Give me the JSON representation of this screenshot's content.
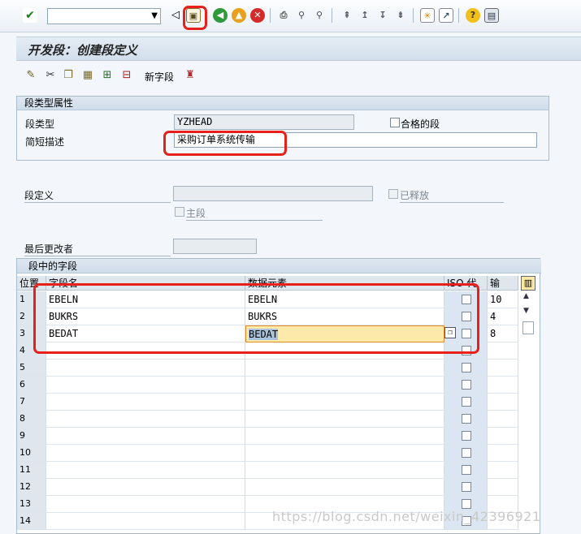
{
  "toolbar": {
    "command_field_value": "",
    "icons": [
      "enter-check-icon",
      "command-dropdown-icon",
      "nav-left-icon",
      "save-icon",
      "back-icon",
      "exit-icon",
      "cancel-icon",
      "print-icon",
      "find-icon",
      "find-next-icon",
      "first-page-icon",
      "prev-page-icon",
      "next-page-icon",
      "last-page-icon",
      "new-session-icon",
      "shortcut-icon",
      "help-icon",
      "layout-icon"
    ]
  },
  "title": "开发段：创建段定义",
  "app_toolbar": {
    "new_field_label": "新字段"
  },
  "segment_attributes": {
    "header": "段类型属性",
    "segment_type_label": "段类型",
    "segment_type_value": "YZHEAD",
    "qualified_label": "合格的段",
    "short_desc_label": "简短描述",
    "short_desc_value": "采购订单系统传输"
  },
  "segment_def": {
    "label": "段定义",
    "value": "",
    "released_label": "已释放",
    "primary_label": "主段",
    "last_changed_label": "最后更改者",
    "last_changed_value": ""
  },
  "fields_table": {
    "header": "段中的字段",
    "columns": [
      "位置",
      "字段名",
      "数据元素",
      "ISO 代",
      "输"
    ],
    "rows": [
      {
        "pos": "1",
        "field": "EBELN",
        "element": "EBELN",
        "len": "10"
      },
      {
        "pos": "2",
        "field": "BUKRS",
        "element": "BUKRS",
        "len": "4"
      },
      {
        "pos": "3",
        "field": "BEDAT",
        "element": "BEDAT",
        "len": "8"
      },
      {
        "pos": "4",
        "field": "",
        "element": "",
        "len": ""
      },
      {
        "pos": "5",
        "field": "",
        "element": "",
        "len": ""
      },
      {
        "pos": "6",
        "field": "",
        "element": "",
        "len": ""
      },
      {
        "pos": "7",
        "field": "",
        "element": "",
        "len": ""
      },
      {
        "pos": "8",
        "field": "",
        "element": "",
        "len": ""
      },
      {
        "pos": "9",
        "field": "",
        "element": "",
        "len": ""
      },
      {
        "pos": "10",
        "field": "",
        "element": "",
        "len": ""
      },
      {
        "pos": "11",
        "field": "",
        "element": "",
        "len": ""
      },
      {
        "pos": "12",
        "field": "",
        "element": "",
        "len": ""
      },
      {
        "pos": "13",
        "field": "",
        "element": "",
        "len": ""
      },
      {
        "pos": "14",
        "field": "",
        "element": "",
        "len": ""
      }
    ]
  },
  "watermark": "https://blog.csdn.net/weixin_42396921",
  "colors": {
    "highlight_red": "#e8201c",
    "selected_cell": "#fde9a9"
  }
}
